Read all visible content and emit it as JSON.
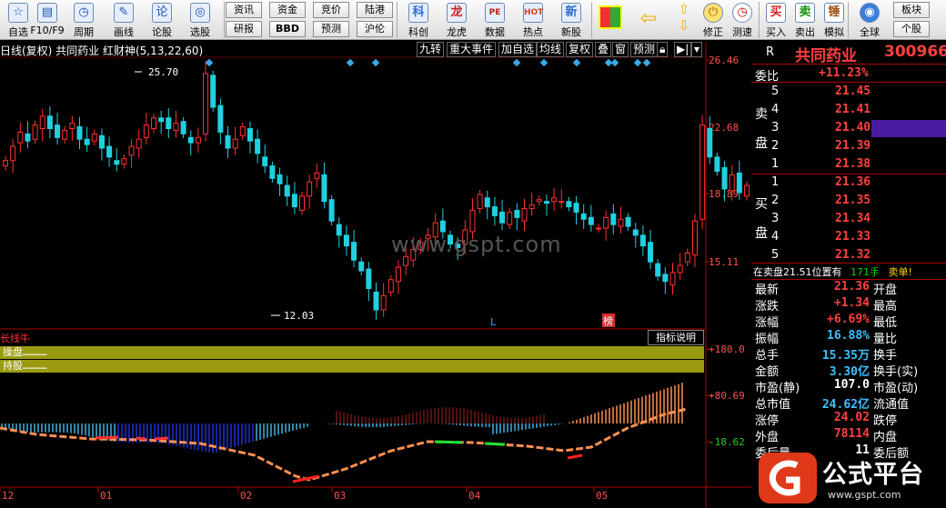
{
  "toolbar": {
    "left_labels": [
      "自选",
      "F10/F9",
      "周期",
      "画线",
      "论股",
      "选股"
    ],
    "left_icons": [
      "watchlist-icon",
      "f10-icon",
      "period-icon",
      "draw-icon",
      "discuss-icon",
      "pick-icon"
    ],
    "small_buttons": [
      [
        "资讯",
        "研报"
      ],
      [
        "资金",
        "BBD"
      ],
      [
        "竞价",
        "预测"
      ],
      [
        "陆港",
        "沪伦"
      ]
    ],
    "big_labels": [
      "科创",
      "龙虎",
      "数据",
      "热点",
      "新股"
    ],
    "big_icons": [
      "kechuang-icon",
      "longhu-icon",
      "data-pe-icon",
      "hot-icon",
      "ipo-icon"
    ],
    "nav_labels": [
      "",
      "",
      "修正",
      "测速"
    ],
    "trade_labels": [
      "买入",
      "卖出",
      "模拟"
    ],
    "trade_glyphs": [
      "买",
      "卖",
      "锤"
    ],
    "right_labels": [
      "全球",
      "板块",
      "个股"
    ]
  },
  "chart": {
    "title": "日线(复权)  共同药业  红财神(5,13,22,60)",
    "controls": [
      "九转",
      "重大事件",
      "加自选",
      "均线",
      "复权",
      "叠",
      "窗",
      "预测"
    ],
    "price_axis": [
      "26.46",
      "22.68",
      "18.89",
      "15.11"
    ],
    "max_label": "25.70",
    "min_label": "12.03",
    "marker_L": "L",
    "marker_rank": "榜",
    "watermark": "www.gspt.com",
    "indicator_name": "长线牛",
    "indicator_explain": "指标说明",
    "osc_axis": [
      "+180.0",
      "+80.69",
      "-18.62"
    ],
    "months": [
      "12",
      "01",
      "02",
      "03",
      "04",
      "05"
    ],
    "bands": [
      "操盘…………",
      "持股…………"
    ]
  },
  "quote": {
    "tag": "R",
    "name": "共同药业",
    "code": "300966",
    "weibi_label": "委比",
    "weibi": "+11.23%",
    "sell_label": [
      "卖",
      "盘"
    ],
    "buy_label": [
      "买",
      "盘"
    ],
    "asks": [
      [
        "5",
        "21.45"
      ],
      [
        "4",
        "21.41"
      ],
      [
        "3",
        "21.40"
      ],
      [
        "2",
        "21.39"
      ],
      [
        "1",
        "21.38"
      ]
    ],
    "bids": [
      [
        "1",
        "21.36"
      ],
      [
        "2",
        "21.35"
      ],
      [
        "3",
        "21.34"
      ],
      [
        "4",
        "21.33"
      ],
      [
        "5",
        "21.32"
      ]
    ],
    "notice_pre": "在卖盘21.51位置有",
    "notice_qty": "171手",
    "notice_post": "卖单!",
    "stats": [
      {
        "l": "最新",
        "v": "21.36",
        "c": "red",
        "l2": "开盘"
      },
      {
        "l": "涨跌",
        "v": "+1.34",
        "c": "red",
        "l2": "最高"
      },
      {
        "l": "涨幅",
        "v": "+6.69%",
        "c": "red",
        "l2": "最低"
      },
      {
        "l": "振幅",
        "v": "16.88%",
        "c": "cyan",
        "l2": "量比"
      },
      {
        "l": "总手",
        "v": "15.35万",
        "c": "cyan",
        "l2": "换手"
      },
      {
        "l": "金额",
        "v": "3.30亿",
        "c": "cyan",
        "l2": "换手(实)"
      },
      {
        "l": "市盈(静)",
        "v": "107.0",
        "c": "wht",
        "l2": "市盈(动)"
      },
      {
        "l": "总市值",
        "v": "24.62亿",
        "c": "cyan",
        "l2": "流通值"
      },
      {
        "l": "涨停",
        "v": "24.02",
        "c": "red",
        "l2": "跌停"
      },
      {
        "l": "外盘",
        "v": "78114",
        "c": "red",
        "l2": "内盘"
      },
      {
        "l": "委后量",
        "v": "11",
        "c": "wht",
        "l2": "委后额"
      }
    ]
  },
  "logo": {
    "text": "公式平台",
    "url": "www.gspt.com"
  }
}
